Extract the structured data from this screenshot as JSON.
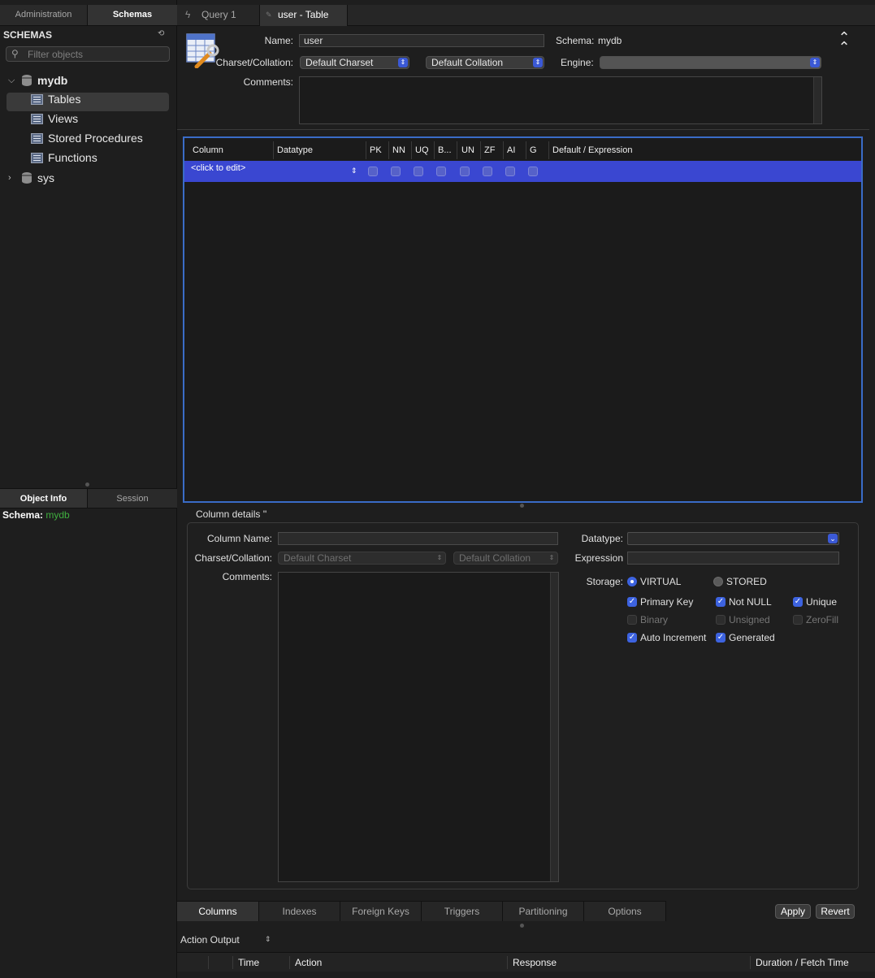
{
  "left": {
    "tabs": [
      "Administration",
      "Schemas"
    ],
    "schemas_title": "SCHEMAS",
    "filter_placeholder": "Filter objects",
    "tree": {
      "db1": "mydb",
      "items": [
        "Tables",
        "Views",
        "Stored Procedures",
        "Functions"
      ],
      "db2": "sys"
    },
    "info_tabs": [
      "Object Info",
      "Session"
    ],
    "info": {
      "label": "Schema:",
      "value": "mydb"
    }
  },
  "editor_tabs": [
    "Query 1",
    "user - Table"
  ],
  "table": {
    "name_label": "Name:",
    "name_value": "user",
    "schema_label": "Schema:",
    "schema_value": "mydb",
    "charset_label": "Charset/Collation:",
    "charset": "Default Charset",
    "collation": "Default Collation",
    "engine_label": "Engine:",
    "engine": "",
    "comments_label": "Comments:"
  },
  "grid": {
    "headers": [
      "Column",
      "Datatype",
      "PK",
      "NN",
      "UQ",
      "B...",
      "UN",
      "ZF",
      "AI",
      "G",
      "Default / Expression"
    ],
    "row_placeholder": "<click to edit>"
  },
  "details": {
    "title": "Column details ''",
    "column_name_label": "Column Name:",
    "charset_label": "Charset/Collation:",
    "charset": "Default Charset",
    "collation": "Default Collation",
    "comments_label": "Comments:",
    "datatype_label": "Datatype:",
    "expression_label": "Expression",
    "storage_label": "Storage:",
    "virtual": "VIRTUAL",
    "stored": "STORED",
    "checks": {
      "primary_key": "Primary Key",
      "not_null": "Not NULL",
      "unique": "Unique",
      "binary": "Binary",
      "unsigned": "Unsigned",
      "zerofill": "ZeroFill",
      "auto_increment": "Auto Increment",
      "generated": "Generated"
    }
  },
  "bottom_tabs": [
    "Columns",
    "Indexes",
    "Foreign Keys",
    "Triggers",
    "Partitioning",
    "Options"
  ],
  "buttons": {
    "apply": "Apply",
    "revert": "Revert"
  },
  "output": {
    "selector": "Action Output",
    "headers": [
      "Time",
      "Action",
      "Response",
      "Duration / Fetch Time"
    ]
  },
  "colors": {
    "accent": "#3b59d6",
    "selection": "#3a47d1",
    "schema_value": "#3fae3f",
    "focus_border": "#3a6cc7"
  }
}
